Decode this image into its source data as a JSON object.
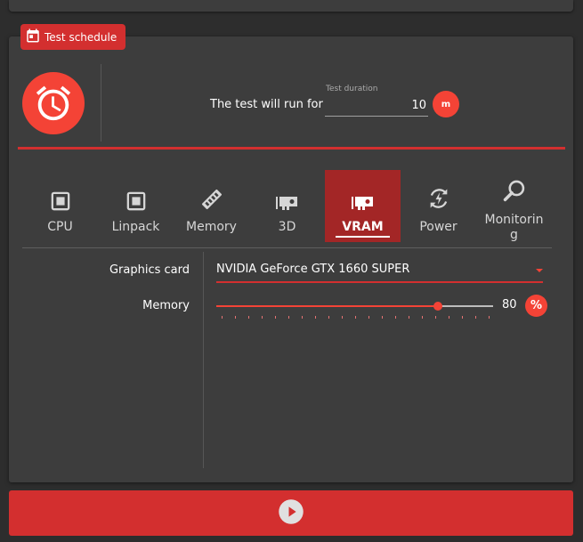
{
  "schedule": {
    "badge_label": "Test schedule",
    "run_text": "The test will run for",
    "duration_label": "Test duration",
    "duration_value": "10",
    "duration_unit": "m"
  },
  "tabs": [
    {
      "label": "CPU",
      "icon": "chip-icon",
      "active": false
    },
    {
      "label": "Linpack",
      "icon": "chip-icon",
      "active": false
    },
    {
      "label": "Memory",
      "icon": "memory-icon",
      "active": false
    },
    {
      "label": "3D",
      "icon": "gpu-icon",
      "active": false
    },
    {
      "label": "VRAM",
      "icon": "gpu-icon",
      "active": true
    },
    {
      "label": "Power",
      "icon": "power-cycle-icon",
      "active": false
    },
    {
      "label": "Monitoring",
      "icon": "magnifier-icon",
      "active": false
    }
  ],
  "form": {
    "graphics_card_label": "Graphics card",
    "graphics_card_value": "NVIDIA GeForce GTX 1660 SUPER",
    "memory_label": "Memory",
    "memory_value": "80",
    "memory_unit": "%",
    "memory_fraction": 0.8
  },
  "colors": {
    "accent": "#d32f2f",
    "accent_light": "#f44336",
    "tab_active_bg": "#a32626",
    "panel_bg": "#3d3d3d",
    "page_bg": "#2d2d2d"
  },
  "icons": {
    "badge": "calendar-icon",
    "timer": "alarm-clock-icon",
    "start": "play-icon"
  }
}
